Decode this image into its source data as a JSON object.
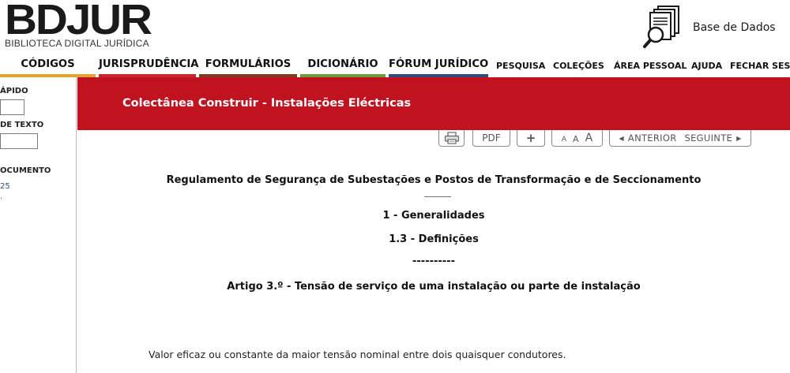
{
  "header": {
    "logo_main": "BDJUR",
    "logo_sub": "BIBLIOTECA DIGITAL JURÍDICA",
    "database_label": "Base de Dados"
  },
  "nav": {
    "main": [
      "CÓDIGOS",
      "JURISPRUDÊNCIA",
      "FORMULÁRIOS",
      "DICIONÁRIO",
      "FÓRUM JURÍDICO"
    ],
    "secondary": [
      "PESQUISA",
      "COLEÇÕES",
      "ÁREA PESSOAL",
      "AJUDA",
      "FECHAR SESS"
    ],
    "bar_colors": [
      "#e2a336",
      "#c8282c",
      "#7d3b22",
      "#6d9b3c",
      "#2f4d7e"
    ]
  },
  "sidebar": {
    "label_1": "ÁPIDO",
    "label_2": "DE TEXTO",
    "label_3": "OCUMENTO",
    "link": "25",
    "dot": "."
  },
  "title_bar": {
    "title": "Colectânea Construir - Instalações Eléctricas",
    "color": "#c1121f"
  },
  "toolbar": {
    "print_icon": "printer-icon",
    "pdf_label": "PDF",
    "plus_label": "+",
    "font_sizes": [
      "A",
      "A",
      "A"
    ],
    "prev_label": "ANTERIOR",
    "next_label": "SEGUINTE",
    "prev_icon": "triangle-left-icon",
    "next_icon": "triangle-right-icon"
  },
  "content": {
    "document_title": "Regulamento de Segurança de Subestações e Postos de Transformação e de Seccionamento",
    "section": "1 - Generalidades",
    "subsection": "1.3 - Definições",
    "separator": "----------",
    "article": "Artigo 3.º - Tensão de serviço de uma instalação ou parte de instalação",
    "body": "Valor eficaz ou constante da maior tensão nominal entre dois quaisquer condutores."
  }
}
